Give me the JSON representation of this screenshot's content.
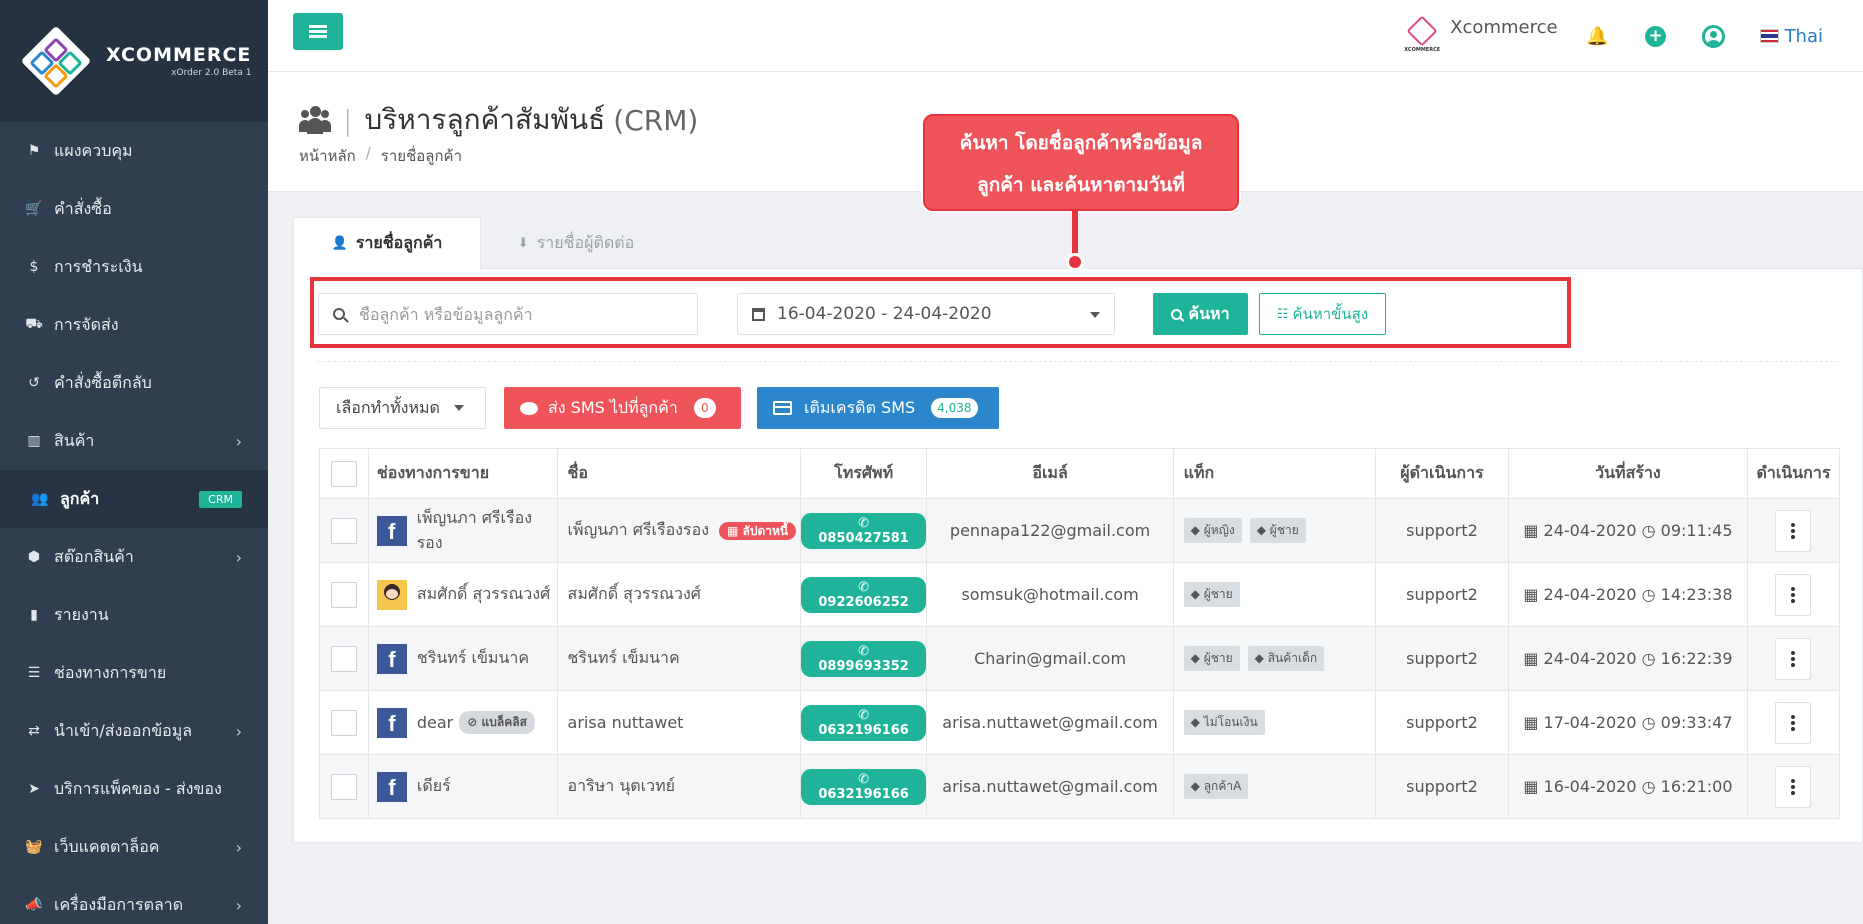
{
  "brand": {
    "name": "XCOMMERCE",
    "version": "xOrder 2.0 Beta 1"
  },
  "sidebar": {
    "items": [
      {
        "label": "แผงควบคุม",
        "icon": "flag-icon",
        "glyph": "⚑",
        "chevron": false
      },
      {
        "label": "คำสั่งซื้อ",
        "icon": "cart-icon",
        "glyph": "🛒",
        "chevron": false
      },
      {
        "label": "การชำระเงิน",
        "icon": "dollar-icon",
        "glyph": "$",
        "chevron": false
      },
      {
        "label": "การจัดส่ง",
        "icon": "truck-icon",
        "glyph": "⛟",
        "chevron": false
      },
      {
        "label": "คำสั่งซื้อตีกลับ",
        "icon": "undo-icon",
        "glyph": "↺",
        "chevron": false
      },
      {
        "label": "สินค้า",
        "icon": "barcode-icon",
        "glyph": "▥",
        "chevron": true
      },
      {
        "label": "ลูกค้า",
        "icon": "users-icon",
        "glyph": "👥",
        "badge": "CRM",
        "active": true
      },
      {
        "label": "สต๊อกสินค้า",
        "icon": "cubes-icon",
        "glyph": "⬢",
        "chevron": true
      },
      {
        "label": "รายงาน",
        "icon": "bar-chart-icon",
        "glyph": "▮",
        "chevron": false
      },
      {
        "label": "ช่องทางการขาย",
        "icon": "list-icon",
        "glyph": "☰",
        "chevron": false
      },
      {
        "label": "นำเข้า/ส่งออกข้อมูล",
        "icon": "exchange-icon",
        "glyph": "⇄",
        "chevron": true
      },
      {
        "label": "บริการแพ็คของ - ส่งของ",
        "icon": "paper-plane-icon",
        "glyph": "➤",
        "chevron": false
      },
      {
        "label": "เว็บแคตตาล็อค",
        "icon": "basket-icon",
        "glyph": "🧺",
        "chevron": true
      },
      {
        "label": "เครื่องมือการตลาด",
        "icon": "bullhorn-icon",
        "glyph": "📣",
        "chevron": true
      }
    ]
  },
  "topbar": {
    "shop_name": "Xcommerce",
    "shop_logo_text": "XCOMMERCE",
    "language": "Thai"
  },
  "page": {
    "title": "บริหารลูกค้าสัมพันธ์",
    "title_suffix": "(CRM)",
    "breadcrumb": [
      "หน้าหลัก",
      "รายชื่อลูกค้า"
    ]
  },
  "callout": {
    "line1": "ค้นหา โดยชื่อลูกค้าหรือข้อมูล",
    "line2": "ลูกค้า และค้นหาตามวันที่"
  },
  "tabs": [
    {
      "label": "รายชื่อลูกค้า",
      "active": true
    },
    {
      "label": "รายชื่อผู้ติดต่อ",
      "active": false
    }
  ],
  "search": {
    "placeholder": "ชื่อลูกค้า หรือข้อมูลลูกค้า",
    "date_range": "16-04-2020 - 24-04-2020",
    "search_label": "ค้นหา",
    "advanced_label": "ค้นหาขั้นสูง"
  },
  "actions": {
    "select_all": "เลือกทำทั้งหมด",
    "sms_label": "ส่ง SMS ไปที่ลูกค้า",
    "sms_count": "0",
    "credit_label": "เติมเครดิต SMS",
    "credit_count": "4,038"
  },
  "table": {
    "columns": [
      "ช่องทางการขาย",
      "ชื่อ",
      "โทรศัพท์",
      "อีเมล์",
      "แท็ก",
      "ผู้ดำเนินการ",
      "วันที่สร้าง",
      "ดำเนินการ"
    ],
    "rows": [
      {
        "channel_type": "facebook",
        "channel_name": "เพ็ญนภา ศรีเรืองรอง",
        "name": "เพ็ญนภา ศรีเรืองรอง",
        "name_badge": "ลัปดาหนี้",
        "phone": "0850427581",
        "email": "pennapa122@gmail.com",
        "tags": [
          "ผู้หญิง",
          "ผู้ชาย"
        ],
        "operator": "support2",
        "date": "24-04-2020",
        "time": "09:11:45"
      },
      {
        "channel_type": "avatar",
        "channel_name": "สมศักดิ์ สุวรรณวงศ์",
        "name": "สมศักดิ์ สุวรรณวงศ์",
        "phone": "0922606252",
        "email": "somsuk@hotmail.com",
        "tags": [
          "ผู้ชาย"
        ],
        "operator": "support2",
        "date": "24-04-2020",
        "time": "14:23:38"
      },
      {
        "channel_type": "facebook",
        "channel_name": "ชรินทร์ เข็มนาค",
        "name": "ชรินทร์ เข็มนาค",
        "phone": "0899693352",
        "email": "Charin@gmail.com",
        "tags": [
          "ผู้ชาย",
          "สินค้าเด็ก"
        ],
        "operator": "support2",
        "date": "24-04-2020",
        "time": "16:22:39"
      },
      {
        "channel_type": "facebook",
        "channel_name": "dear",
        "channel_badge": "แบล็คลิส",
        "name": "arisa nuttawet",
        "phone": "0632196166",
        "email": "arisa.nuttawet@gmail.com",
        "tags": [
          "ไม่โอนเงิน"
        ],
        "operator": "support2",
        "date": "17-04-2020",
        "time": "09:33:47"
      },
      {
        "channel_type": "facebook",
        "channel_name": "เดียร์",
        "name": "อาริษา นุตเวทย์",
        "phone": "0632196166",
        "email": "arisa.nuttawet@gmail.com",
        "tags": [
          "ลูกค้าA"
        ],
        "operator": "support2",
        "date": "16-04-2020",
        "time": "16:21:00"
      }
    ]
  },
  "colors": {
    "accent": "#1fb49a",
    "danger": "#ef545b",
    "primary": "#2c86cc",
    "sidebar": "#2f3f50"
  }
}
